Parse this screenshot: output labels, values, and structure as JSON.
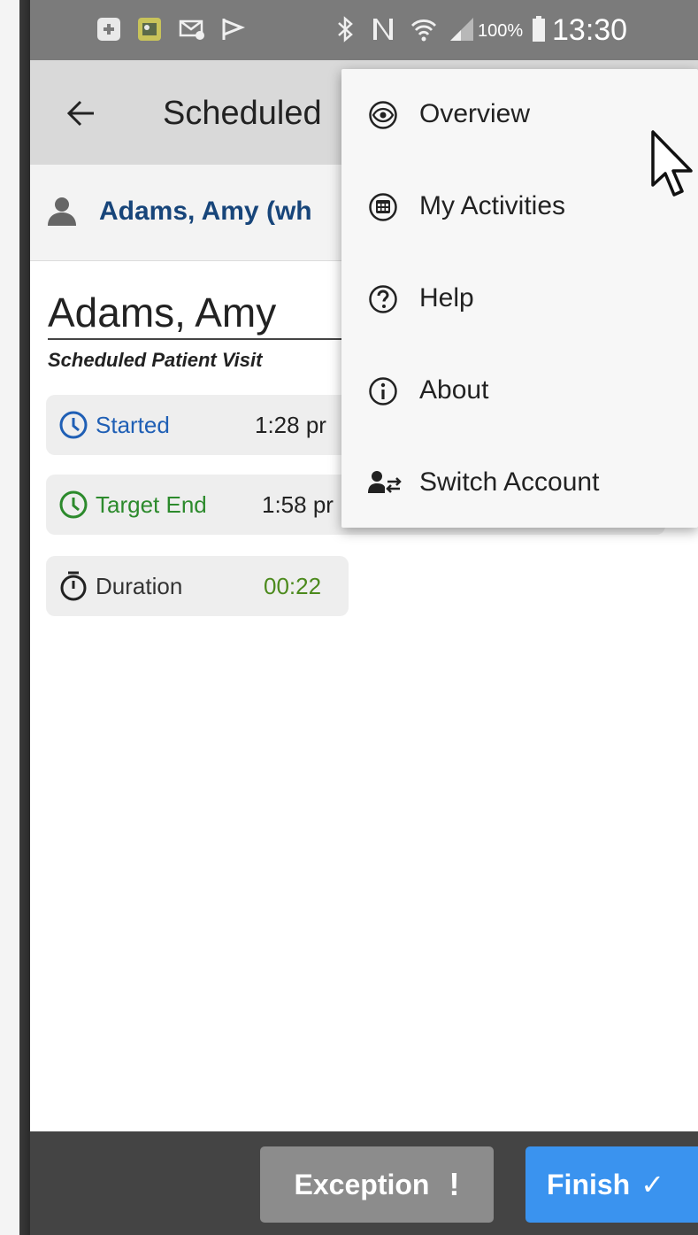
{
  "status_bar": {
    "icons": [
      "notification-app-icon",
      "notification-image-icon",
      "email-icon",
      "flag-icon",
      "bluetooth-icon",
      "nfc-icon",
      "wifi-icon",
      "signal-icon"
    ],
    "battery_percent": "100%",
    "time": "13:30"
  },
  "app_bar": {
    "title": "Scheduled"
  },
  "patient": {
    "link_text": "Adams, Amy (wh",
    "name": "Adams, Amy",
    "visit_type": "Scheduled Patient Visit"
  },
  "times": {
    "started_label": "Started",
    "started_value": "1:28 pr",
    "target_end_label": "Target End",
    "target_end_value": "1:58 pr",
    "duration_label": "Duration",
    "duration_value": "00:22"
  },
  "menu": {
    "items": [
      {
        "label": "Overview",
        "icon": "eye-icon"
      },
      {
        "label": "My Activities",
        "icon": "calendar-icon"
      },
      {
        "label": "Help",
        "icon": "help-icon"
      },
      {
        "label": "About",
        "icon": "info-icon"
      },
      {
        "label": "Switch Account",
        "icon": "switch-account-icon"
      }
    ]
  },
  "actions": {
    "exception_label": "Exception",
    "exception_symbol": "!",
    "finish_label": "Finish",
    "finish_symbol": "✓"
  },
  "colors": {
    "link_blue": "#17457a",
    "started_blue": "#1f5fb5",
    "target_green": "#2c8a2c",
    "duration_green": "#4c8a1d",
    "finish_blue": "#3a93ef",
    "exception_gray": "#8c8c8c"
  }
}
